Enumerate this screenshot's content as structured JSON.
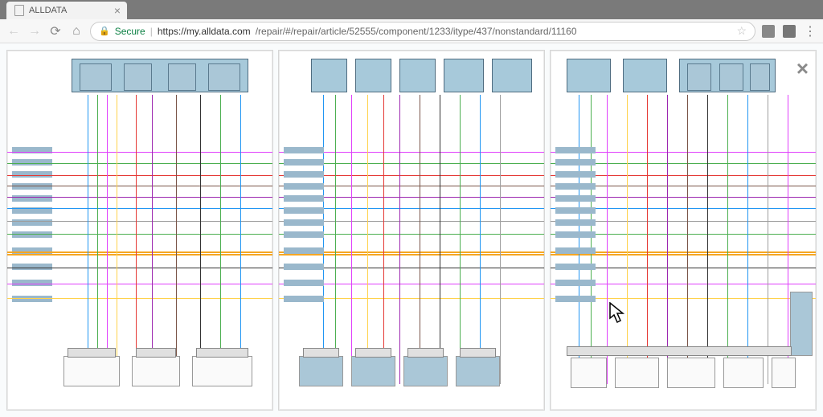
{
  "browser": {
    "tab_title": "ALLDATA",
    "secure_label": "Secure",
    "url_host": "https://my.alldata.com",
    "url_path": "/repair/#/repair/article/52555/component/1233/itype/437/nonstandard/11160"
  },
  "viewer": {
    "close_label": "×",
    "panels": [
      "schematic-page-1",
      "schematic-page-2",
      "schematic-page-3"
    ]
  },
  "wire_colors": {
    "orange": "#f5a623",
    "green": "#4caf50",
    "magenta": "#e040fb",
    "yellow": "#ffd24c",
    "blue": "#2196f3",
    "red": "#e53935",
    "brown": "#795548",
    "violet": "#9c27b0",
    "gray": "#9e9e9e",
    "black": "#333333"
  }
}
